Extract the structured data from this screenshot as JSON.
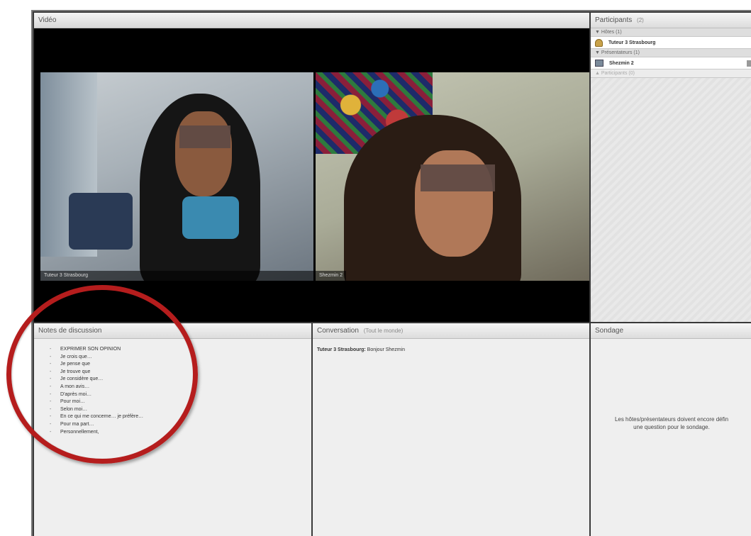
{
  "video": {
    "title": "Vidéo",
    "feeds": [
      {
        "name": "Tuteur 3 Strasbourg"
      },
      {
        "name": "Shezmin 2"
      }
    ]
  },
  "participants": {
    "title": "Participants",
    "count": "(2)",
    "groups": {
      "hosts": {
        "label": "▼ Hôtes (1)",
        "members": [
          "Tuteur 3 Strasbourg"
        ]
      },
      "presenters": {
        "label": "▼ Présentateurs (1)",
        "members": [
          "Shezmin 2"
        ]
      },
      "attendees": {
        "label": "▲ Participants (0)"
      }
    }
  },
  "notes": {
    "title": "Notes de discussion",
    "items": [
      "EXPRIMER SON OPINION",
      "Je crois que…",
      "Je pense que",
      "Je trouve que",
      "Je considère que…",
      "A mon avis…",
      "D'après moi…",
      "Pour moi…",
      "Selon moi…",
      "En ce qui me concerne… je préfère…",
      "Pour ma part…",
      "Personnellement,"
    ]
  },
  "chat": {
    "title": "Conversation",
    "scope": "(Tout le monde)",
    "messages": [
      {
        "sender": "Tuteur 3 Strasbourg:",
        "text": "Bonjour Shezmin"
      }
    ]
  },
  "poll": {
    "title": "Sondage",
    "message_line1": "Les hôtes/présentateurs doivent encore défin",
    "message_line2": "une question pour le sondage."
  },
  "colors": {
    "annotation": "#b51d1d",
    "pod_background": "#efefef",
    "video_background": "#000000"
  }
}
